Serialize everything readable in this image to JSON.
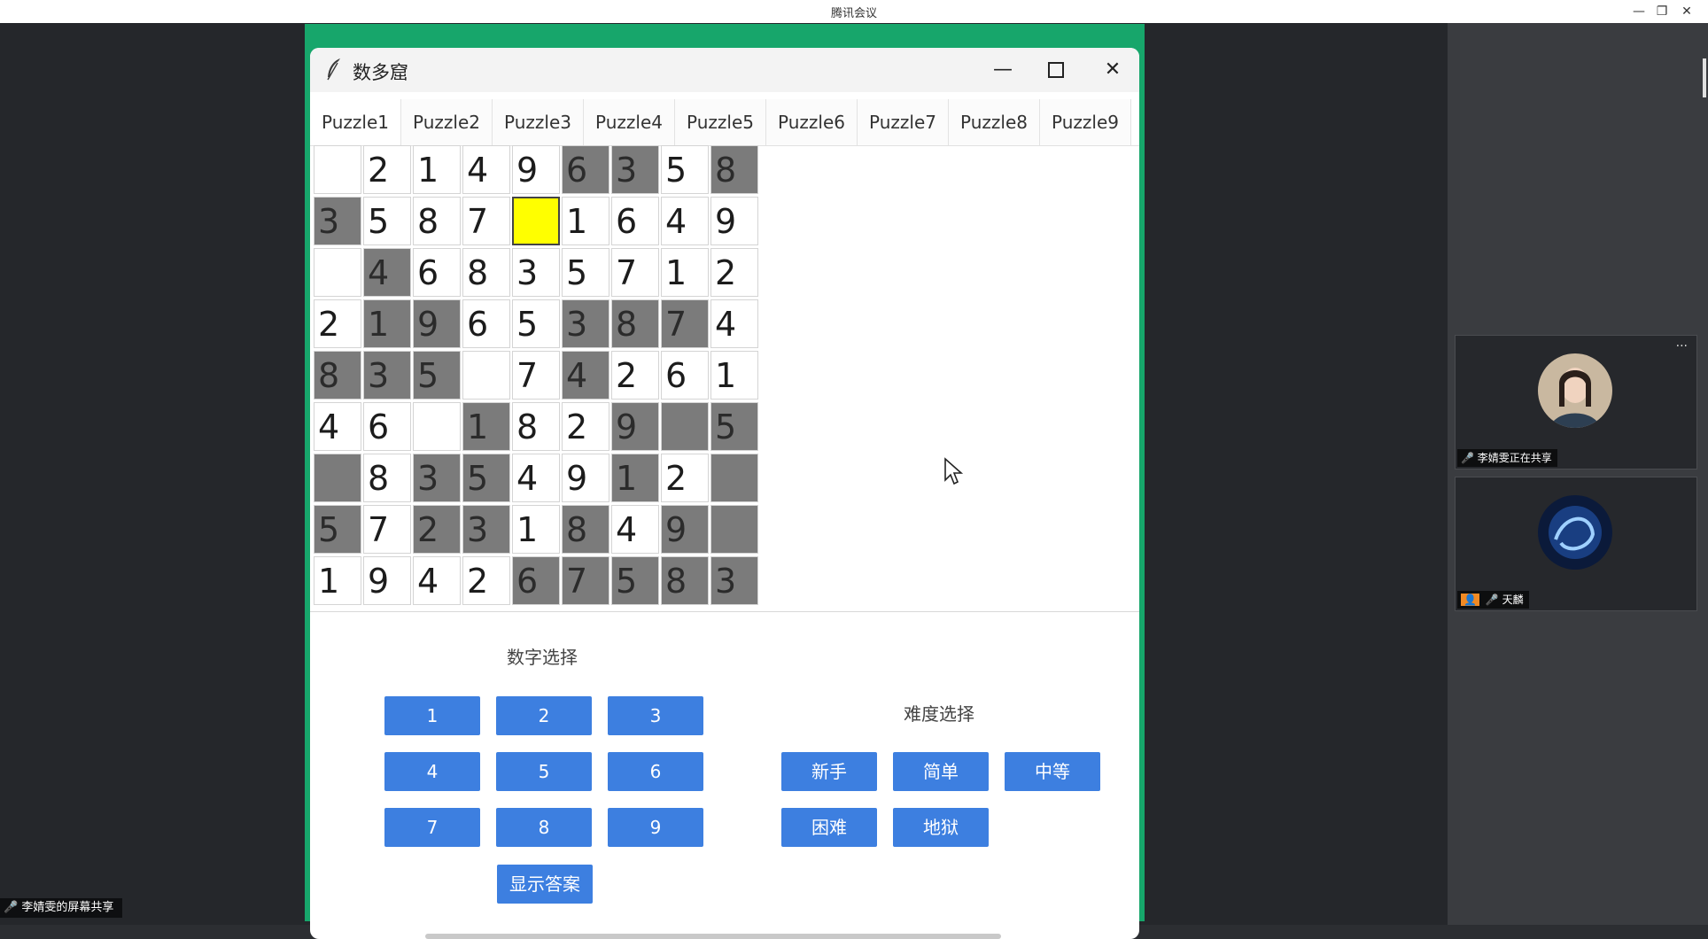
{
  "host": {
    "title": "腾讯会议"
  },
  "app": {
    "title": "数多窟",
    "tabs": [
      "Puzzle1",
      "Puzzle2",
      "Puzzle3",
      "Puzzle4",
      "Puzzle5",
      "Puzzle6",
      "Puzzle7",
      "Puzzle8",
      "Puzzle9"
    ],
    "grid": [
      [
        "",
        "2",
        "1",
        "4",
        "9",
        "6",
        "3",
        "5",
        "8"
      ],
      [
        "3",
        "5",
        "8",
        "7",
        "",
        "1",
        "6",
        "4",
        "9"
      ],
      [
        "",
        "4",
        "6",
        "8",
        "3",
        "5",
        "7",
        "1",
        "2"
      ],
      [
        "2",
        "1",
        "9",
        "6",
        "5",
        "3",
        "8",
        "7",
        "4"
      ],
      [
        "8",
        "3",
        "5",
        "",
        "7",
        "4",
        "2",
        "6",
        "1"
      ],
      [
        "4",
        "6",
        "",
        "1",
        "8",
        "2",
        "9",
        "",
        "5"
      ],
      [
        "",
        "8",
        "3",
        "5",
        "4",
        "9",
        "1",
        "2",
        ""
      ],
      [
        "5",
        "7",
        "2",
        "3",
        "1",
        "8",
        "4",
        "9",
        ""
      ],
      [
        "1",
        "9",
        "4",
        "2",
        "6",
        "7",
        "5",
        "8",
        "3"
      ]
    ],
    "dark": [
      [
        0,
        0,
        0,
        0,
        0,
        1,
        1,
        0,
        1
      ],
      [
        1,
        0,
        0,
        0,
        0,
        0,
        0,
        0,
        0
      ],
      [
        0,
        1,
        0,
        0,
        0,
        0,
        0,
        0,
        0
      ],
      [
        0,
        1,
        1,
        0,
        0,
        1,
        1,
        1,
        0
      ],
      [
        1,
        1,
        1,
        0,
        0,
        1,
        0,
        0,
        0
      ],
      [
        0,
        0,
        0,
        1,
        0,
        0,
        1,
        1,
        1
      ],
      [
        1,
        0,
        1,
        1,
        0,
        0,
        1,
        0,
        1
      ],
      [
        1,
        0,
        1,
        1,
        0,
        1,
        0,
        1,
        1
      ],
      [
        0,
        0,
        0,
        0,
        1,
        1,
        1,
        1,
        1
      ]
    ],
    "selected_cell": [
      1,
      4
    ],
    "number_select_label": "数字选择",
    "number_buttons": [
      "1",
      "2",
      "3",
      "4",
      "5",
      "6",
      "7",
      "8",
      "9"
    ],
    "show_answer": "显示答案",
    "difficulty_label": "难度选择",
    "difficulty_buttons": [
      "新手",
      "简单",
      "中等",
      "困难",
      "地狱"
    ],
    "colors": {
      "accent": "#3d7fe0",
      "selected": "#ffff00",
      "given": "#7b7b7b",
      "frame": "#17a66b"
    }
  },
  "participants": [
    {
      "name": "李婧雯正在共享"
    },
    {
      "name": "天麟"
    }
  ],
  "share_label": "李婧雯的屏幕共享"
}
